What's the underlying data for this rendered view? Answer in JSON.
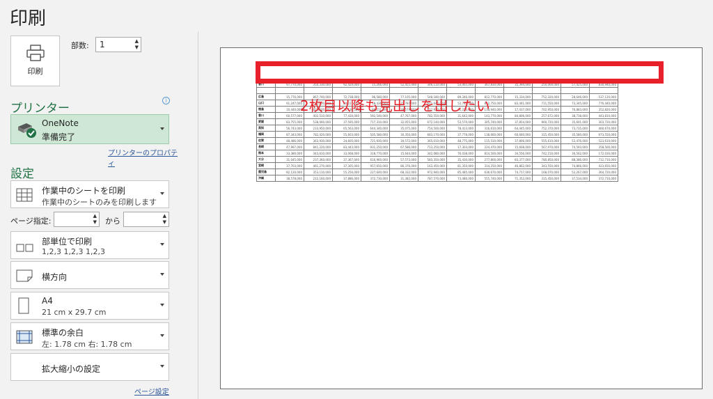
{
  "title": "印刷",
  "print_button": {
    "label": "印刷",
    "icon": "printer-icon"
  },
  "copies": {
    "label": "部数:",
    "value": "1"
  },
  "printer": {
    "section": "プリンター",
    "name": "OneNote",
    "status": "準備完了",
    "properties_link": "プリンターのプロパティ",
    "info_icon": "i"
  },
  "settings": {
    "section": "設定",
    "what": {
      "title": "作業中のシートを印刷",
      "sub": "作業中のシートのみを印刷します"
    },
    "pages": {
      "label": "ページ指定:",
      "to": "から"
    },
    "collate": {
      "title": "部単位で印刷",
      "sub": "1,2,3    1,2,3    1,2,3"
    },
    "orientation": {
      "title": "横方向"
    },
    "paper": {
      "title": "A4",
      "sub": "21 cm x 29.7 cm"
    },
    "margins": {
      "title": "標準の余白",
      "sub": "左: 1.78 cm    右: 1.78 cm"
    },
    "scaling": {
      "title": "拡大縮小の設定"
    },
    "page_setup_link": "ページ設定"
  },
  "preview": {
    "annotation": "2枚目以降も見出しを出したい",
    "highlight_color": "#e8202a",
    "rows": [
      {
        "h": "香川",
        "v": [
          "97,770,000",
          "350,330,000",
          "92,420,000",
          "15,266,000",
          "52,455,000",
          "346,110,000",
          "53,065,000",
          "367,830,000",
          "35,394,000",
          "250,000,000",
          "57,425,000",
          "830,940,000"
        ]
      },
      {
        "h": "",
        "v": [
          "",
          "",
          "",
          "",
          "",
          "",
          "",
          "",
          "",
          "",
          "",
          ""
        ]
      },
      {
        "h": "広島",
        "v": [
          "15,776,000",
          "867,740,000",
          "72,738,000",
          "96,580,000",
          "77,105,000",
          "548,180,000",
          "89,346,000",
          "812,770,000",
          "15,334,000",
          "752,320,000",
          "28,646,000",
          "537,120,000"
        ]
      },
      {
        "h": "山口",
        "v": [
          "91,247,000",
          "712,920,000",
          "30,237,000",
          "18,436,000",
          "21,787,000",
          "621,640,000",
          "52,744,000",
          "812,750,000",
          "83,441,000",
          "711,550,000",
          "73,345,000",
          "776,440,000"
        ]
      },
      {
        "h": "徳島",
        "v": [
          "10,440,000",
          "821,500,000",
          "76,130,000",
          "88,211,000",
          "39,574,000",
          "812,920,000",
          "71,233,000",
          "138,940,000",
          "17,437,000",
          "702,950,000",
          "76,883,000",
          "352,820,000"
        ]
      },
      {
        "h": "香川",
        "v": [
          "60,577,000",
          "402,510,000",
          "77,430,000",
          "592,540,000",
          "47,767,000",
          "782,550,000",
          "31,642,000",
          "143,770,000",
          "84,806,000",
          "257,672,000",
          "38,738,000",
          "443,810,000"
        ]
      },
      {
        "h": "愛媛",
        "v": [
          "83,755,000",
          "538,060,000",
          "37,595,000",
          "717,310,000",
          "32,055,000",
          "672,140,000",
          "53,570,000",
          "305,740,000",
          "37,854,000",
          "960,720,000",
          "35,601,000",
          "303,720,000"
        ]
      },
      {
        "h": "高知",
        "v": [
          "56,743,000",
          "233,950,000",
          "65,563,000",
          "644,340,000",
          "35,075,000",
          "754,500,000",
          "78,413,000",
          "316,610,000",
          "64,445,000",
          "752,370,000",
          "73,735,000",
          "460,670,000"
        ]
      },
      {
        "h": "福岡",
        "v": [
          "87,343,000",
          "782,020,000",
          "55,603,000",
          "505,580,000",
          "30,350,000",
          "683,170,000",
          "37,778,000",
          "138,660,000",
          "60,660,000",
          "315,450,000",
          "35,580,000",
          "673,550,000"
        ]
      },
      {
        "h": "佐賀",
        "v": [
          "48,486,000",
          "363,930,000",
          "24,605,000",
          "721,930,000",
          "30,572,000",
          "365,010,000",
          "48,775,000",
          "115,510,000",
          "37,806,000",
          "555,610,000",
          "53,476,000",
          "523,610,000"
        ]
      },
      {
        "h": "長崎",
        "v": [
          "47,997,000",
          "841,220,000",
          "83,443,000",
          "931,250,000",
          "67,586,000",
          "713,250,000",
          "17,303,000",
          "224,470,000",
          "15,608,000",
          "567,970,000",
          "74,593,000",
          "358,500,000"
        ]
      },
      {
        "h": "熊本",
        "v": [
          "33,380,000",
          "343,610,000",
          "33,068,000",
          "318,770,000",
          "15,644,000",
          "342,080,000",
          "76,038,000",
          "814,500,000",
          "34,556,000",
          "742,150,000",
          "30,562,000",
          "172,030,000"
        ]
      },
      {
        "h": "大分",
        "v": [
          "31,045,000",
          "237,360,000",
          "37,367,000",
          "616,960,000",
          "57,573,000",
          "583,350,000",
          "35,430,000",
          "277,800,000",
          "83,377,000",
          "780,850,000",
          "88,386,000",
          "712,710,000"
        ]
      },
      {
        "h": "宮崎",
        "v": [
          "37,703,000",
          "461,270,000",
          "37,305,000",
          "957,650,000",
          "86,376,000",
          "163,450,000",
          "81,350,000",
          "314,250,000",
          "46,862,000",
          "343,550,000",
          "74,866,000",
          "423,650,000"
        ]
      },
      {
        "h": "鹿児島",
        "v": [
          "82,120,000",
          "353,110,000",
          "55,256,000",
          "227,640,000",
          "68,332,000",
          "972,940,000",
          "85,485,000",
          "636,670,000",
          "74,717,000",
          "168,070,000",
          "52,267,000",
          "364,720,000"
        ]
      },
      {
        "h": "沖縄",
        "v": [
          "38,578,000",
          "222,160,000",
          "37,886,000",
          "372,730,000",
          "31,382,000",
          "787,570,000",
          "73,480,000",
          "555,740,000",
          "71,352,000",
          "315,450,000",
          "37,534,000",
          "372,710,000"
        ]
      }
    ]
  }
}
